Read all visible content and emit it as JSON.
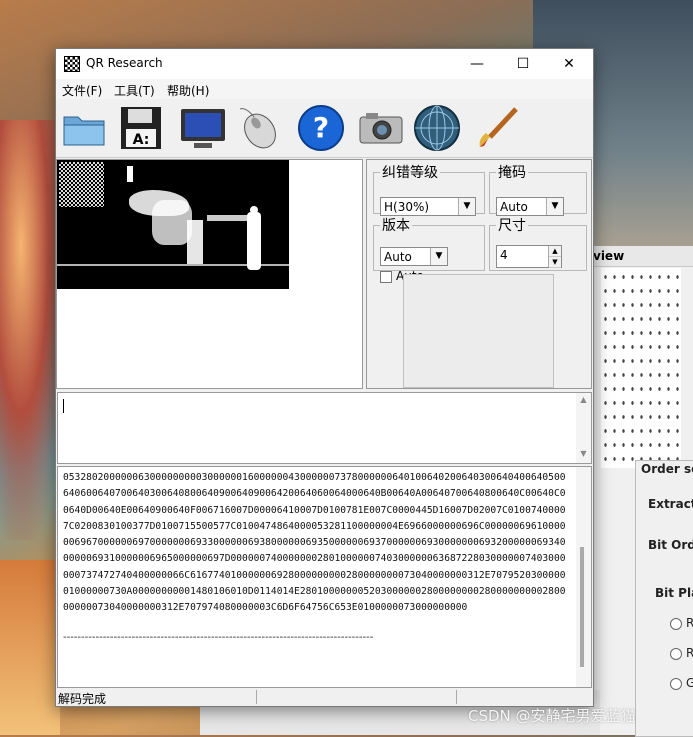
{
  "window": {
    "title": "QR Research",
    "minimize": "—",
    "maximize": "☐",
    "close": "✕"
  },
  "menu": {
    "file": "文件(F)",
    "tools": "工具(T)",
    "help": "帮助(H)"
  },
  "toolbar": [
    "open-folder-icon",
    "save-floppy-icon",
    "monitor-icon",
    "mouse-icon",
    "help-icon",
    "camera-icon",
    "globe-icon",
    "brush-icon"
  ],
  "options": {
    "ecc": {
      "label": "纠错等级",
      "value": "H(30%)"
    },
    "mask": {
      "label": "掩码",
      "value": "Auto"
    },
    "version": {
      "label": "版本",
      "value": "Auto",
      "auto_checkbox": "Auto"
    },
    "size": {
      "label": "尺寸",
      "value": "4"
    }
  },
  "output": {
    "hex": "0532802000000630000000003000000160000004300000073780000006401006402006403006404006405006406006407006403006408006409006409006420064060064000640B00640A00640700640800640C00640C00640D00640E00640900640F006716007D00006410007D0100781E007C0000445D16007D02007C01007400007C0200830100377D0100715500577C0100474864000053281100000004E6966000000696C000000696100000069670000006970000000693300000069380000006935000000693700000069300000006932000000693400000069310000006965000000697D0000007400000002801000000740300000063687228030000007403000000737472740400000066C616774010000006928000000000280000000073040000000312E707952030000001000000730A00000000001480106010D0114014E280100000005203000000280000000028000000000280000000073040000000312E707974080000003C6D6F64756C653E0100000073000000000",
    "separator": "--------------------------------------------------------------------------------------"
  },
  "status": {
    "text": "解码完成"
  },
  "background_window": {
    "header": "view",
    "order_settings": "Order set",
    "extract": "Extract",
    "bit_order": "Bit Orde",
    "bit_plane": "Bit Plan",
    "radio": [
      "R",
      "R",
      "G"
    ]
  },
  "watermark": "CSDN @安静宅男爱蓝猫"
}
